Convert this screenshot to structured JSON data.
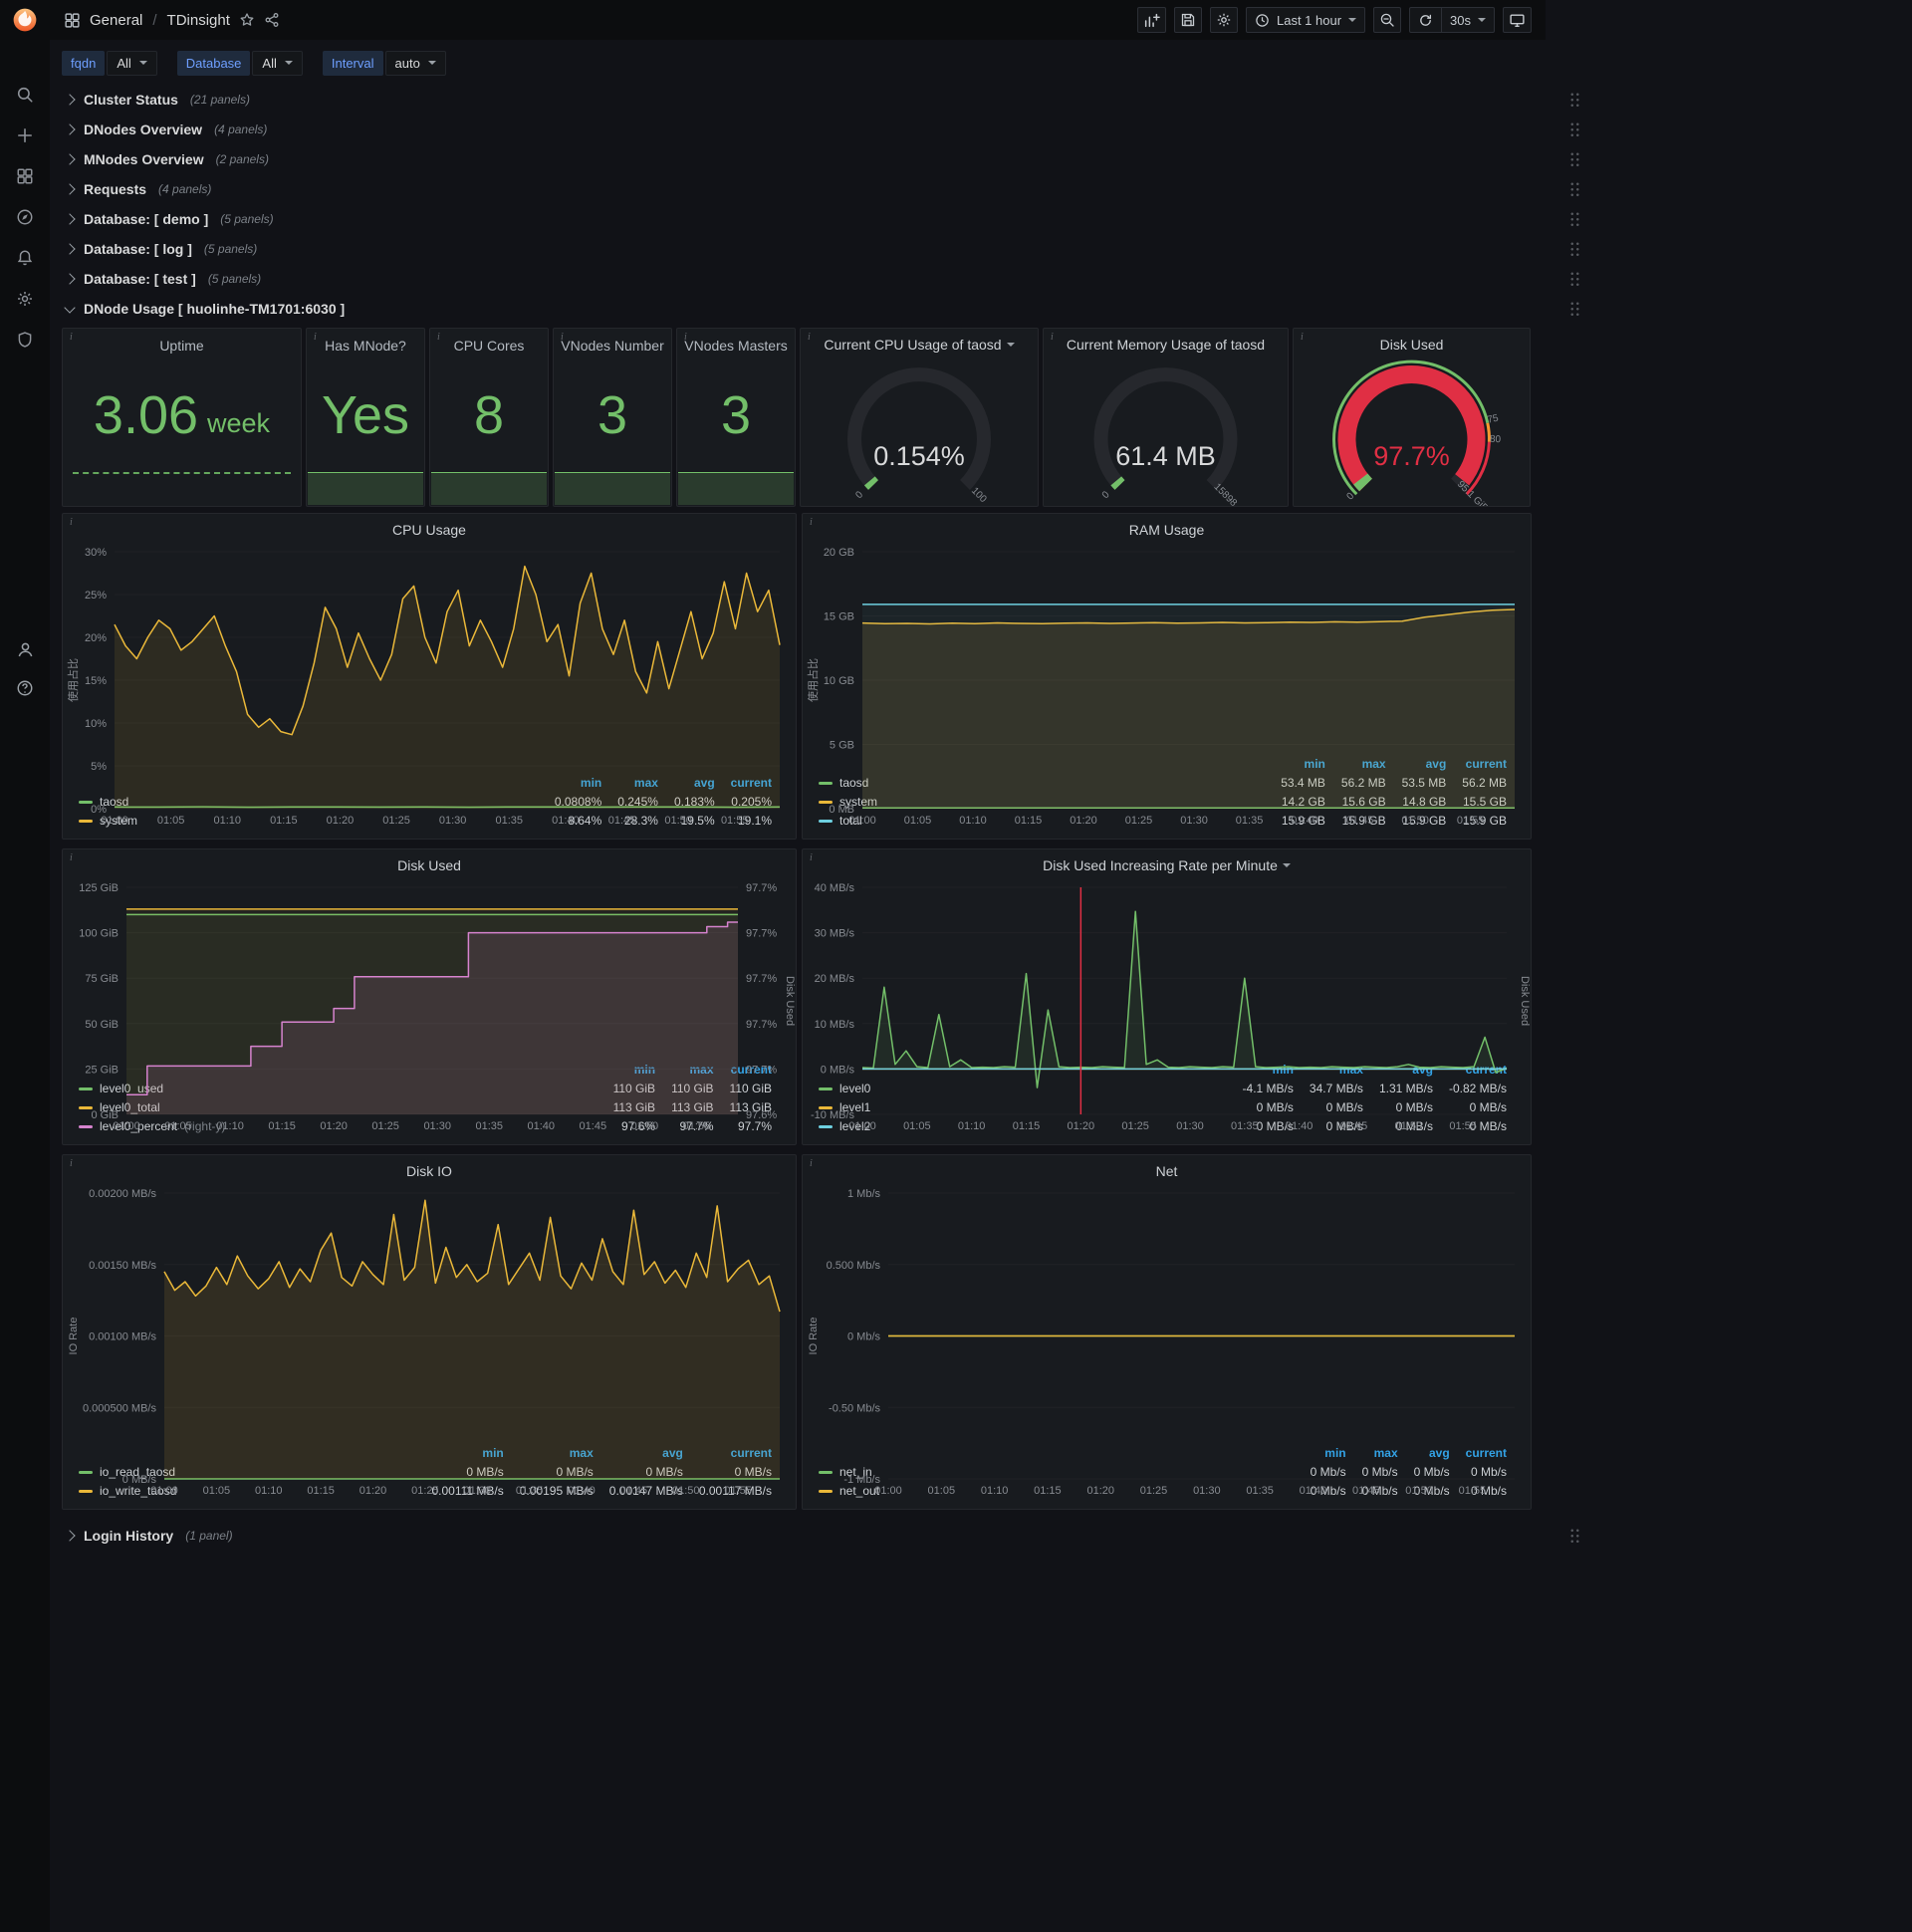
{
  "navbar": {
    "breadcrumb": {
      "folder": "General",
      "separator": "/",
      "dashboard": "TDinsight"
    },
    "time_picker": "Last 1 hour",
    "refresh_interval": "30s",
    "icons": [
      "dashboard",
      "star",
      "share",
      "add-panel",
      "save",
      "settings",
      "clock",
      "zoom-out",
      "refresh",
      "cycle-view"
    ]
  },
  "sidebar": {
    "icons": [
      "grafana-logo",
      "search",
      "add",
      "dashboards",
      "explore",
      "alerting",
      "configuration",
      "shield",
      "avatar",
      "help"
    ]
  },
  "variables": [
    {
      "label": "fqdn",
      "value": "All"
    },
    {
      "label": "Database",
      "value": "All"
    },
    {
      "label": "Interval",
      "value": "auto"
    }
  ],
  "rows_top": [
    {
      "title": "Cluster Status",
      "count": "(21 panels)"
    },
    {
      "title": "DNodes Overview",
      "count": "(4 panels)"
    },
    {
      "title": "MNodes Overview",
      "count": "(2 panels)"
    },
    {
      "title": "Requests",
      "count": "(4 panels)"
    },
    {
      "title": "Database: [ demo ]",
      "count": "(5 panels)"
    },
    {
      "title": "Database: [ log ]",
      "count": "(5 panels)"
    },
    {
      "title": "Database: [ test ]",
      "count": "(5 panels)"
    }
  ],
  "expanded_row": {
    "title": "DNode Usage [ huolinhe-TM1701:6030 ]"
  },
  "bottom_row": {
    "title": "Login History",
    "count": "(1 panel)"
  },
  "stats": [
    {
      "title": "Uptime",
      "value": "3.06",
      "suffix": "week",
      "style": "dashed"
    },
    {
      "title": "Has MNode?",
      "value": "Yes",
      "style": "area"
    },
    {
      "title": "CPU Cores",
      "value": "8",
      "style": "area"
    },
    {
      "title": "VNodes Number",
      "value": "3",
      "style": "area"
    },
    {
      "title": "VNodes Masters",
      "value": "3",
      "style": "area"
    }
  ],
  "gauges": [
    {
      "title": "Current CPU Usage of taosd",
      "caret": true,
      "value": "0.154%",
      "frac": 0.00154,
      "min_label": "0",
      "max_label": "100",
      "arc_color": "#73bf69",
      "value_color": "#d8d9da"
    },
    {
      "title": "Current Memory Usage of taosd",
      "caret": false,
      "value": "61.4 MB",
      "frac": 0.0039,
      "min_label": "0",
      "max_label": "15898",
      "arc_color": "#73bf69",
      "value_color": "#d8d9da"
    },
    {
      "title": "Disk Used",
      "caret": false,
      "value": "97.7%",
      "frac": 0.977,
      "min_label": "0",
      "max_label": "95.1 GiB",
      "arc_color": "#e02f44",
      "value_color": "#e02f44",
      "outer_ring": "#73bf69",
      "thresholds": [
        {
          "label": "75",
          "frac": 0.789
        },
        {
          "label": "80",
          "frac": 0.841
        }
      ]
    }
  ],
  "chart_data": [
    {
      "key": "cpu",
      "type": "line",
      "title": "CPU Usage",
      "caret": false,
      "left_label": "使用占比",
      "ml": 52,
      "mr": 16,
      "y_ticks": [
        "30%",
        "25%",
        "20%",
        "15%",
        "10%",
        "5%",
        "0%"
      ],
      "y_min": 0,
      "y_max": 30,
      "x_ticks": [
        "01:00",
        "01:05",
        "01:10",
        "01:15",
        "01:20",
        "01:25",
        "01:30",
        "01:35",
        "01:40",
        "01:45",
        "01:50",
        "01:55"
      ],
      "series": [
        {
          "name": "taosd",
          "color": "#73bf69",
          "fill": 0.08,
          "values": [
            0.2,
            0.19,
            0.22,
            0.18,
            0.2,
            0.21,
            0.19,
            0.2,
            0.18,
            0.21,
            0.2,
            0.19,
            0.21,
            0.2,
            0.18,
            0.2
          ]
        },
        {
          "name": "system",
          "color": "#eab839",
          "fill": 0.1,
          "values": [
            21.5,
            19,
            17.5,
            20,
            22,
            21,
            18.5,
            19.5,
            21,
            22.5,
            19,
            16,
            11,
            9.5,
            10.5,
            9,
            8.64,
            12,
            17,
            23.5,
            21,
            16.5,
            20.5,
            17.5,
            15,
            18,
            24.5,
            26,
            20,
            17,
            23,
            25.5,
            19,
            22,
            19.5,
            16.5,
            21,
            28.3,
            25,
            19.5,
            21.5,
            15.5,
            24,
            27.5,
            21,
            18,
            22,
            16,
            13.5,
            19.5,
            14,
            18.5,
            23,
            17.5,
            20.5,
            26.5,
            21,
            27.5,
            23,
            25.5,
            19.1
          ]
        }
      ],
      "legend": {
        "cols": [
          "min",
          "max",
          "avg",
          "current"
        ],
        "rows": [
          {
            "name": "taosd",
            "color": "#73bf69",
            "values": [
              "0.0808%",
              "0.245%",
              "0.183%",
              "0.205%"
            ]
          },
          {
            "name": "system",
            "color": "#eab839",
            "values": [
              "8.64%",
              "28.3%",
              "19.5%",
              "19.1%"
            ]
          }
        ]
      }
    },
    {
      "key": "ram",
      "type": "line",
      "title": "RAM Usage",
      "caret": false,
      "left_label": "使用占比",
      "ml": 60,
      "mr": 16,
      "y_ticks": [
        "20 GB",
        "15 GB",
        "10 GB",
        "5 GB",
        "0 MB"
      ],
      "y_min": 0,
      "y_max": 20,
      "x_ticks": [
        "01:00",
        "01:05",
        "01:10",
        "01:15",
        "01:20",
        "01:25",
        "01:30",
        "01:35",
        "01:40",
        "01:45",
        "01:50",
        "01:55"
      ],
      "series": [
        {
          "name": "taosd",
          "color": "#73bf69",
          "fill": 0.1,
          "values": [
            0.055,
            0.055
          ]
        },
        {
          "name": "system",
          "color": "#eab839",
          "fill": 0.12,
          "values": [
            14.45,
            14.4,
            14.42,
            14.38,
            14.44,
            14.4,
            14.46,
            14.42,
            14.4,
            14.44,
            14.46,
            14.42,
            14.45,
            14.48,
            14.44,
            14.46,
            14.5,
            14.46,
            14.48,
            14.52,
            14.5,
            14.54,
            14.52,
            14.56,
            14.6,
            14.9,
            15.1,
            15.3,
            15.45,
            15.5
          ]
        },
        {
          "name": "total",
          "color": "#6ed0e0",
          "fill": 0.05,
          "values": [
            15.9,
            15.9
          ]
        }
      ],
      "legend": {
        "cols": [
          "min",
          "max",
          "avg",
          "current"
        ],
        "rows": [
          {
            "name": "taosd",
            "color": "#73bf69",
            "values": [
              "53.4 MB",
              "56.2 MB",
              "53.5 MB",
              "56.2 MB"
            ]
          },
          {
            "name": "system",
            "color": "#eab839",
            "values": [
              "14.2 GB",
              "15.6 GB",
              "14.8 GB",
              "15.5 GB"
            ]
          },
          {
            "name": "total",
            "color": "#6ed0e0",
            "values": [
              "15.9 GB",
              "15.9 GB",
              "15.9 GB",
              "15.9 GB"
            ]
          }
        ]
      }
    },
    {
      "key": "disk",
      "type": "line",
      "title": "Disk Used",
      "caret": false,
      "ml": 64,
      "mr": 58,
      "right_label": "Disk Used",
      "y_ticks": [
        "125 GiB",
        "100 GiB",
        "75 GiB",
        "50 GiB",
        "25 GiB",
        "0 GiB"
      ],
      "y_min": 0,
      "y_max": 125,
      "right_ticks": [
        "97.7%",
        "97.7%",
        "97.7%",
        "97.7%",
        "97.7%",
        "97.6%"
      ],
      "right_min": 97.575,
      "right_max": 97.725,
      "x_ticks": [
        "01:00",
        "01:05",
        "01:10",
        "01:15",
        "01:20",
        "01:25",
        "01:30",
        "01:35",
        "01:40",
        "01:45",
        "01:50",
        "01:55"
      ],
      "series": [
        {
          "name": "level0_used",
          "color": "#73bf69",
          "fill": 0.06,
          "values": [
            110,
            110
          ]
        },
        {
          "name": "level0_total",
          "color": "#eab839",
          "fill": 0.06,
          "values": [
            113,
            113
          ]
        },
        {
          "name": "level0_percent",
          "color": "#d683ce",
          "fill": 0.12,
          "step": true,
          "scale": [
            97.575,
            97.725
          ],
          "values": [
            97.588,
            97.588,
            97.607,
            97.607,
            97.607,
            97.607,
            97.607,
            97.607,
            97.607,
            97.607,
            97.607,
            97.607,
            97.62,
            97.62,
            97.62,
            97.636,
            97.636,
            97.636,
            97.636,
            97.636,
            97.645,
            97.645,
            97.666,
            97.666,
            97.666,
            97.666,
            97.666,
            97.666,
            97.666,
            97.666,
            97.666,
            97.666,
            97.666,
            97.695,
            97.695,
            97.695,
            97.695,
            97.695,
            97.695,
            97.695,
            97.695,
            97.695,
            97.695,
            97.695,
            97.695,
            97.695,
            97.695,
            97.695,
            97.695,
            97.695,
            97.695,
            97.695,
            97.695,
            97.695,
            97.695,
            97.695,
            97.699,
            97.699,
            97.702,
            97.702
          ]
        }
      ],
      "legend": {
        "cols": [
          "min",
          "max",
          "current"
        ],
        "rows": [
          {
            "name": "level0_used",
            "color": "#73bf69",
            "values": [
              "110 GiB",
              "110 GiB",
              "110 GiB"
            ]
          },
          {
            "name": "level0_total",
            "color": "#eab839",
            "values": [
              "113 GiB",
              "113 GiB",
              "113 GiB"
            ]
          },
          {
            "name": "level0_percent",
            "suffix": "(right-y)",
            "color": "#d683ce",
            "values": [
              "97.6%",
              "97.7%",
              "97.7%"
            ]
          }
        ]
      }
    },
    {
      "key": "diskrate",
      "type": "line",
      "title": "Disk Used Increasing Rate per Minute",
      "caret": true,
      "ml": 60,
      "mr": 24,
      "right_label": "Disk Used",
      "annotation_frac": 0.339,
      "y_ticks": [
        "40 MB/s",
        "30 MB/s",
        "20 MB/s",
        "10 MB/s",
        "0 MB/s",
        "-10 MB/s"
      ],
      "y_min": -10,
      "y_max": 40,
      "x_ticks": [
        "01:00",
        "01:05",
        "01:10",
        "01:15",
        "01:20",
        "01:25",
        "01:30",
        "01:35",
        "01:40",
        "01:45",
        "01:50",
        "01:55"
      ],
      "series": [
        {
          "name": "level0",
          "color": "#73bf69",
          "fill": 0.1,
          "values": [
            0.3,
            0.2,
            18,
            1,
            4,
            0.5,
            0.3,
            12,
            0.5,
            2,
            0.3,
            0.4,
            0.3,
            0.5,
            0.4,
            21,
            -4.1,
            13,
            0.5,
            0.3,
            0.4,
            0.3,
            0.5,
            0.4,
            0.3,
            34.7,
            1,
            2,
            0.4,
            0.3,
            0.5,
            0.4,
            0.3,
            0.5,
            0.4,
            20,
            0.5,
            0.3,
            0.4,
            0.5,
            0.3,
            0.4,
            0.3,
            0.5,
            0.4,
            0.3,
            0.5,
            0.4,
            0.3,
            0.5,
            1,
            0.4,
            0.3,
            0.5,
            0.4,
            0.3,
            0.5,
            7,
            -0.8,
            0.2
          ]
        },
        {
          "name": "level1",
          "color": "#eab839",
          "fill": 0,
          "values": [
            0,
            0
          ]
        },
        {
          "name": "level2",
          "color": "#6ed0e0",
          "fill": 0,
          "values": [
            0,
            0
          ]
        }
      ],
      "legend": {
        "cols": [
          "min",
          "max",
          "avg",
          "current"
        ],
        "rows": [
          {
            "name": "level0",
            "color": "#73bf69",
            "values": [
              "-4.1 MB/s",
              "34.7 MB/s",
              "1.31 MB/s",
              "-0.82 MB/s"
            ]
          },
          {
            "name": "level1",
            "color": "#eab839",
            "values": [
              "0 MB/s",
              "0 MB/s",
              "0 MB/s",
              "0 MB/s"
            ]
          },
          {
            "name": "level2",
            "color": "#6ed0e0",
            "values": [
              "0 MB/s",
              "0 MB/s",
              "0 MB/s",
              "0 MB/s"
            ]
          }
        ]
      }
    },
    {
      "key": "diskio",
      "type": "line",
      "title": "Disk IO",
      "caret": false,
      "left_label": "IO Rate",
      "ml": 102,
      "mr": 16,
      "y_ticks": [
        "0.00200 MB/s",
        "0.00150 MB/s",
        "0.00100 MB/s",
        "0.000500 MB/s",
        "0 MB/s"
      ],
      "y_min": 0,
      "y_max": 0.002,
      "x_ticks": [
        "01:00",
        "01:05",
        "01:10",
        "01:15",
        "01:20",
        "01:25",
        "01:30",
        "01:35",
        "01:40",
        "01:45",
        "01:50",
        "01:55"
      ],
      "series": [
        {
          "name": "io_read_taosd",
          "color": "#73bf69",
          "fill": 0,
          "values": [
            0,
            0
          ]
        },
        {
          "name": "io_write_taosd",
          "color": "#eab839",
          "fill": 0.12,
          "values": [
            0.00145,
            0.00132,
            0.00138,
            0.00128,
            0.00135,
            0.00148,
            0.00136,
            0.00156,
            0.00142,
            0.00133,
            0.0014,
            0.00152,
            0.00134,
            0.00147,
            0.00138,
            0.0016,
            0.00172,
            0.00141,
            0.00135,
            0.00152,
            0.00143,
            0.00136,
            0.00185,
            0.00139,
            0.00148,
            0.00195,
            0.00137,
            0.00162,
            0.00141,
            0.0015,
            0.00138,
            0.00144,
            0.00178,
            0.00136,
            0.00147,
            0.00158,
            0.00139,
            0.00183,
            0.00142,
            0.00133,
            0.00151,
            0.00139,
            0.00168,
            0.00145,
            0.00136,
            0.00188,
            0.00143,
            0.00152,
            0.00137,
            0.00146,
            0.00134,
            0.00158,
            0.00141,
            0.00191,
            0.00138,
            0.00147,
            0.00153,
            0.00136,
            0.00142,
            0.00117
          ]
        }
      ],
      "legend": {
        "cols": [
          "min",
          "max",
          "avg",
          "current"
        ],
        "rows": [
          {
            "name": "io_read_taosd",
            "color": "#73bf69",
            "values": [
              "0 MB/s",
              "0 MB/s",
              "0 MB/s",
              "0 MB/s"
            ]
          },
          {
            "name": "io_write_taosd",
            "color": "#eab839",
            "values": [
              "0.00111 MB/s",
              "0.00195 MB/s",
              "0.00147 MB/s",
              "0.00117 MB/s"
            ]
          }
        ]
      }
    },
    {
      "key": "net",
      "type": "line",
      "title": "Net",
      "caret": false,
      "left_label": "IO Rate",
      "ml": 86,
      "mr": 16,
      "y_ticks": [
        "1 Mb/s",
        "0.500 Mb/s",
        "0 Mb/s",
        "-0.50 Mb/s",
        "-1 Mb/s"
      ],
      "y_min": -1,
      "y_max": 1,
      "x_ticks": [
        "01:00",
        "01:05",
        "01:10",
        "01:15",
        "01:20",
        "01:25",
        "01:30",
        "01:35",
        "01:40",
        "01:45",
        "01:50",
        "01:55"
      ],
      "series": [
        {
          "name": "net_in",
          "color": "#73bf69",
          "fill": 0,
          "values": [
            0,
            0
          ]
        },
        {
          "name": "net_out",
          "color": "#eab839",
          "fill": 0,
          "values": [
            0,
            0
          ]
        }
      ],
      "legend": {
        "cols": [
          "min",
          "max",
          "avg",
          "current"
        ],
        "rows": [
          {
            "name": "net_in",
            "color": "#73bf69",
            "values": [
              "0 Mb/s",
              "0 Mb/s",
              "0 Mb/s",
              "0 Mb/s"
            ]
          },
          {
            "name": "net_out",
            "color": "#eab839",
            "values": [
              "0 Mb/s",
              "0 Mb/s",
              "0 Mb/s",
              "0 Mb/s"
            ]
          }
        ]
      }
    }
  ],
  "colors": {
    "green": "#73bf69",
    "yellow": "#eab839",
    "blue": "#6ed0e0",
    "pink": "#d683ce",
    "red": "#e02f44",
    "legend_header": "#33a2e5",
    "panel_bg": "#181b1f",
    "page_bg": "#111217"
  }
}
